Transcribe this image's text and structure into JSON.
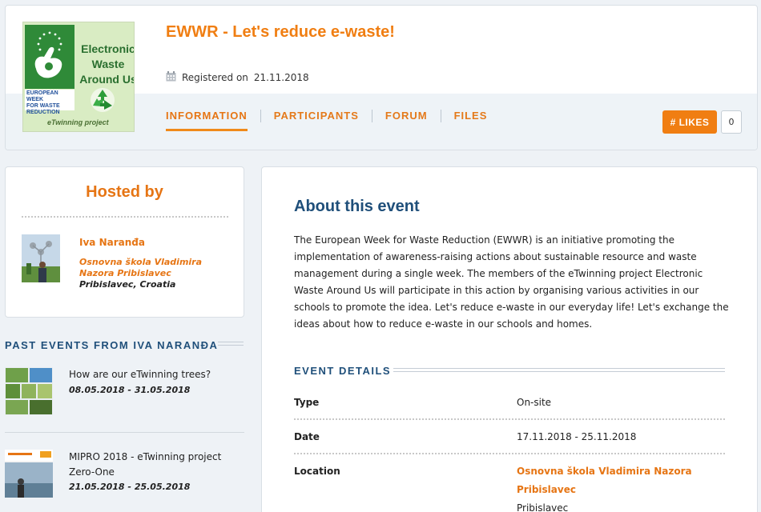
{
  "event": {
    "title": "EWWR - Let's reduce e-waste!",
    "registered_label": "Registered on",
    "registered_date": "21.11.2018"
  },
  "logo": {
    "text_lines": [
      "Electronic",
      "Waste",
      "Around Us"
    ],
    "ewwr_lines": [
      "EUROPEAN WEEK",
      "FOR WASTE",
      "REDUCTION"
    ],
    "footer": "eTwinning project"
  },
  "tabs": [
    {
      "label": "INFORMATION",
      "active": true
    },
    {
      "label": "PARTICIPANTS",
      "active": false
    },
    {
      "label": "FORUM",
      "active": false
    },
    {
      "label": "FILES",
      "active": false
    }
  ],
  "likes": {
    "label": "# LIKES",
    "count": "0"
  },
  "host": {
    "heading": "Hosted by",
    "name": "Iva Naranđa",
    "school": "Osnovna škola Vladimira Nazora Pribislavec",
    "place": "Pribislavec, Croatia"
  },
  "past_events": {
    "heading": "PAST EVENTS FROM IVA NARANĐA",
    "items": [
      {
        "name": "How are our eTwinning trees?",
        "dates": "08.05.2018 - 31.05.2018"
      },
      {
        "name": "MIPRO 2018 - eTwinning project Zero-One",
        "dates": "21.05.2018 - 25.05.2018"
      }
    ]
  },
  "about": {
    "heading": "About this event",
    "text": "The European Week for Waste Reduction (EWWR) is an initiative promoting the implementation of awareness-raising actions about sustainable resource and waste management during a single week. The members of the eTwinning project Electronic Waste Around Us will participate in this action by organising various activities in our schools to promote the idea. Let's reduce e-waste in our everyday life! Let's exchange the ideas about how to reduce e-waste in our schools and homes."
  },
  "details": {
    "heading": "EVENT DETAILS",
    "rows": [
      {
        "label": "Type",
        "value": "On-site"
      },
      {
        "label": "Date",
        "value": "17.11.2018 - 25.11.2018"
      },
      {
        "label": "Location",
        "value_link": "Osnovna škola Vladimira Nazora Pribislavec",
        "value_extra": "Pribislavec"
      }
    ]
  },
  "colors": {
    "accent": "#f07e12",
    "heading_blue": "#1f4f7a"
  }
}
